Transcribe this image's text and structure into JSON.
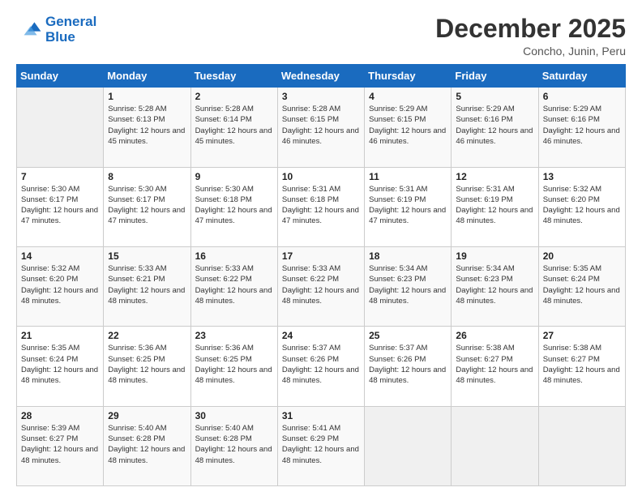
{
  "logo": {
    "line1": "General",
    "line2": "Blue"
  },
  "title": "December 2025",
  "subtitle": "Concho, Junin, Peru",
  "days_header": [
    "Sunday",
    "Monday",
    "Tuesday",
    "Wednesday",
    "Thursday",
    "Friday",
    "Saturday"
  ],
  "weeks": [
    [
      {
        "day": "",
        "empty": true
      },
      {
        "day": "1",
        "sunrise": "Sunrise: 5:28 AM",
        "sunset": "Sunset: 6:13 PM",
        "daylight": "Daylight: 12 hours and 45 minutes."
      },
      {
        "day": "2",
        "sunrise": "Sunrise: 5:28 AM",
        "sunset": "Sunset: 6:14 PM",
        "daylight": "Daylight: 12 hours and 45 minutes."
      },
      {
        "day": "3",
        "sunrise": "Sunrise: 5:28 AM",
        "sunset": "Sunset: 6:15 PM",
        "daylight": "Daylight: 12 hours and 46 minutes."
      },
      {
        "day": "4",
        "sunrise": "Sunrise: 5:29 AM",
        "sunset": "Sunset: 6:15 PM",
        "daylight": "Daylight: 12 hours and 46 minutes."
      },
      {
        "day": "5",
        "sunrise": "Sunrise: 5:29 AM",
        "sunset": "Sunset: 6:16 PM",
        "daylight": "Daylight: 12 hours and 46 minutes."
      },
      {
        "day": "6",
        "sunrise": "Sunrise: 5:29 AM",
        "sunset": "Sunset: 6:16 PM",
        "daylight": "Daylight: 12 hours and 46 minutes."
      }
    ],
    [
      {
        "day": "7",
        "sunrise": "Sunrise: 5:30 AM",
        "sunset": "Sunset: 6:17 PM",
        "daylight": "Daylight: 12 hours and 47 minutes."
      },
      {
        "day": "8",
        "sunrise": "Sunrise: 5:30 AM",
        "sunset": "Sunset: 6:17 PM",
        "daylight": "Daylight: 12 hours and 47 minutes."
      },
      {
        "day": "9",
        "sunrise": "Sunrise: 5:30 AM",
        "sunset": "Sunset: 6:18 PM",
        "daylight": "Daylight: 12 hours and 47 minutes."
      },
      {
        "day": "10",
        "sunrise": "Sunrise: 5:31 AM",
        "sunset": "Sunset: 6:18 PM",
        "daylight": "Daylight: 12 hours and 47 minutes."
      },
      {
        "day": "11",
        "sunrise": "Sunrise: 5:31 AM",
        "sunset": "Sunset: 6:19 PM",
        "daylight": "Daylight: 12 hours and 47 minutes."
      },
      {
        "day": "12",
        "sunrise": "Sunrise: 5:31 AM",
        "sunset": "Sunset: 6:19 PM",
        "daylight": "Daylight: 12 hours and 48 minutes."
      },
      {
        "day": "13",
        "sunrise": "Sunrise: 5:32 AM",
        "sunset": "Sunset: 6:20 PM",
        "daylight": "Daylight: 12 hours and 48 minutes."
      }
    ],
    [
      {
        "day": "14",
        "sunrise": "Sunrise: 5:32 AM",
        "sunset": "Sunset: 6:20 PM",
        "daylight": "Daylight: 12 hours and 48 minutes."
      },
      {
        "day": "15",
        "sunrise": "Sunrise: 5:33 AM",
        "sunset": "Sunset: 6:21 PM",
        "daylight": "Daylight: 12 hours and 48 minutes."
      },
      {
        "day": "16",
        "sunrise": "Sunrise: 5:33 AM",
        "sunset": "Sunset: 6:22 PM",
        "daylight": "Daylight: 12 hours and 48 minutes."
      },
      {
        "day": "17",
        "sunrise": "Sunrise: 5:33 AM",
        "sunset": "Sunset: 6:22 PM",
        "daylight": "Daylight: 12 hours and 48 minutes."
      },
      {
        "day": "18",
        "sunrise": "Sunrise: 5:34 AM",
        "sunset": "Sunset: 6:23 PM",
        "daylight": "Daylight: 12 hours and 48 minutes."
      },
      {
        "day": "19",
        "sunrise": "Sunrise: 5:34 AM",
        "sunset": "Sunset: 6:23 PM",
        "daylight": "Daylight: 12 hours and 48 minutes."
      },
      {
        "day": "20",
        "sunrise": "Sunrise: 5:35 AM",
        "sunset": "Sunset: 6:24 PM",
        "daylight": "Daylight: 12 hours and 48 minutes."
      }
    ],
    [
      {
        "day": "21",
        "sunrise": "Sunrise: 5:35 AM",
        "sunset": "Sunset: 6:24 PM",
        "daylight": "Daylight: 12 hours and 48 minutes."
      },
      {
        "day": "22",
        "sunrise": "Sunrise: 5:36 AM",
        "sunset": "Sunset: 6:25 PM",
        "daylight": "Daylight: 12 hours and 48 minutes."
      },
      {
        "day": "23",
        "sunrise": "Sunrise: 5:36 AM",
        "sunset": "Sunset: 6:25 PM",
        "daylight": "Daylight: 12 hours and 48 minutes."
      },
      {
        "day": "24",
        "sunrise": "Sunrise: 5:37 AM",
        "sunset": "Sunset: 6:26 PM",
        "daylight": "Daylight: 12 hours and 48 minutes."
      },
      {
        "day": "25",
        "sunrise": "Sunrise: 5:37 AM",
        "sunset": "Sunset: 6:26 PM",
        "daylight": "Daylight: 12 hours and 48 minutes."
      },
      {
        "day": "26",
        "sunrise": "Sunrise: 5:38 AM",
        "sunset": "Sunset: 6:27 PM",
        "daylight": "Daylight: 12 hours and 48 minutes."
      },
      {
        "day": "27",
        "sunrise": "Sunrise: 5:38 AM",
        "sunset": "Sunset: 6:27 PM",
        "daylight": "Daylight: 12 hours and 48 minutes."
      }
    ],
    [
      {
        "day": "28",
        "sunrise": "Sunrise: 5:39 AM",
        "sunset": "Sunset: 6:27 PM",
        "daylight": "Daylight: 12 hours and 48 minutes."
      },
      {
        "day": "29",
        "sunrise": "Sunrise: 5:40 AM",
        "sunset": "Sunset: 6:28 PM",
        "daylight": "Daylight: 12 hours and 48 minutes."
      },
      {
        "day": "30",
        "sunrise": "Sunrise: 5:40 AM",
        "sunset": "Sunset: 6:28 PM",
        "daylight": "Daylight: 12 hours and 48 minutes."
      },
      {
        "day": "31",
        "sunrise": "Sunrise: 5:41 AM",
        "sunset": "Sunset: 6:29 PM",
        "daylight": "Daylight: 12 hours and 48 minutes."
      },
      {
        "day": "",
        "empty": true
      },
      {
        "day": "",
        "empty": true
      },
      {
        "day": "",
        "empty": true
      }
    ]
  ]
}
